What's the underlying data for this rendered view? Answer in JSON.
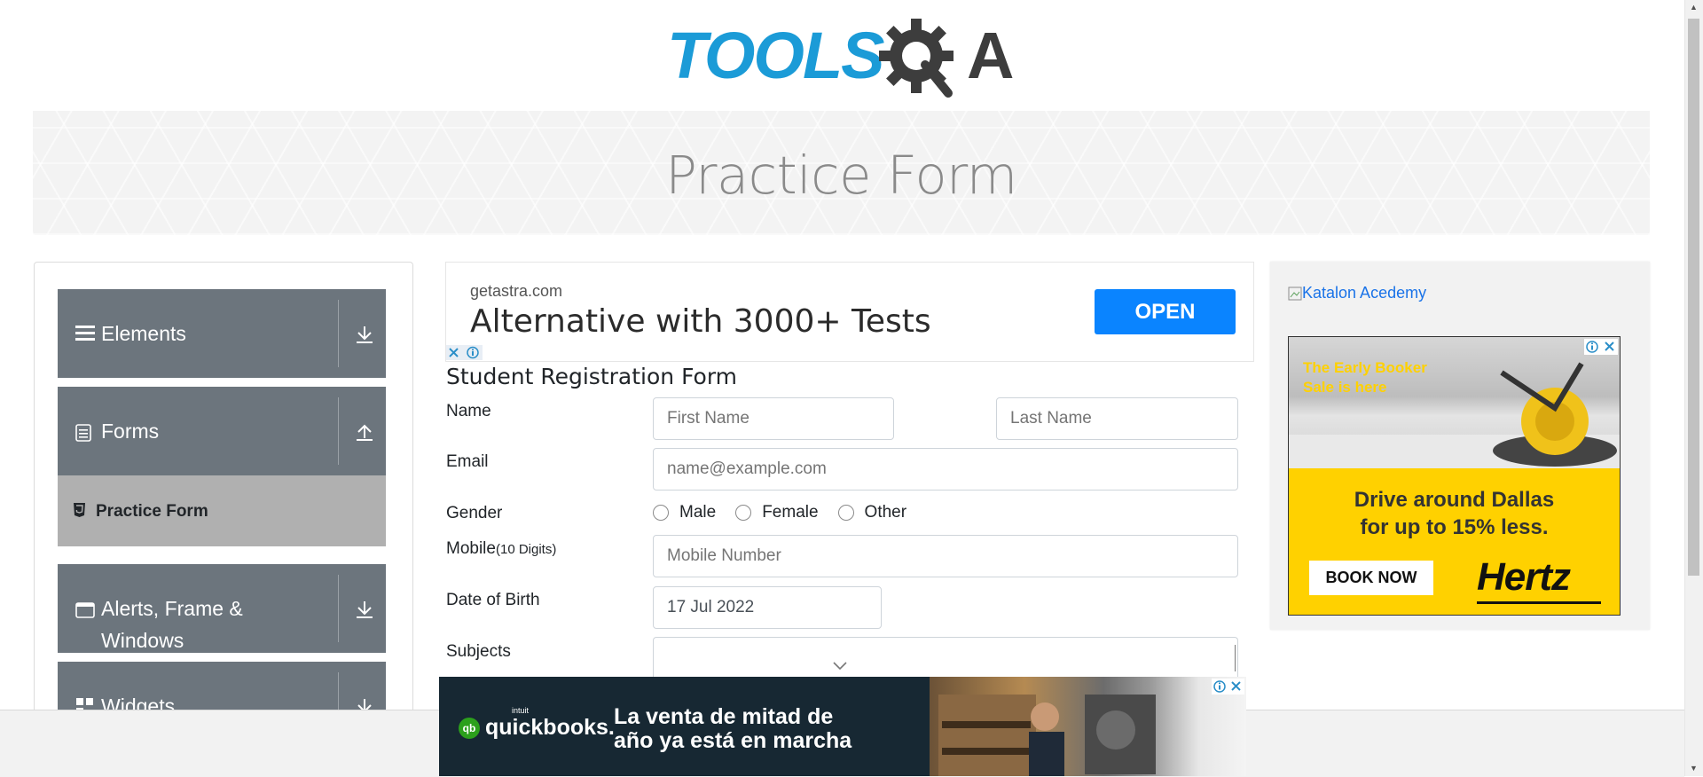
{
  "header": {
    "logo_text": "TOOLSQA"
  },
  "banner": {
    "title": "Practice Form"
  },
  "sidebar": {
    "groups": [
      {
        "label": "Elements",
        "icon": "hamburger-icon",
        "arrow": "download-arrow-icon"
      },
      {
        "label": "Forms",
        "icon": "document-icon",
        "arrow": "upload-arrow-icon"
      },
      {
        "label": "Alerts, Frame &",
        "label2": "Windows",
        "icon": "window-icon",
        "arrow": "download-arrow-icon"
      },
      {
        "label": "Widgets",
        "icon": "widgets-icon",
        "arrow": "download-arrow-icon"
      }
    ],
    "active_item": {
      "label": "Practice Form",
      "icon": "html5-icon"
    }
  },
  "ad_top": {
    "domain": "getastra.com",
    "headline": "Alternative with 3000+ Tests",
    "button": "OPEN"
  },
  "form": {
    "title": "Student Registration Form",
    "name_label": "Name",
    "first_name_placeholder": "First Name",
    "last_name_placeholder": "Last Name",
    "email_label": "Email",
    "email_placeholder": "name@example.com",
    "gender_label": "Gender",
    "gender_options": [
      "Male",
      "Female",
      "Other"
    ],
    "mobile_label": "Mobile",
    "mobile_hint": "(10 Digits)",
    "mobile_placeholder": "Mobile Number",
    "dob_label": "Date of Birth",
    "dob_value": "17 Jul 2022",
    "subjects_label": "Subjects"
  },
  "right_ad": {
    "katalon_alt": "Katalon Acedemy",
    "early_booker": [
      "The Early Booker",
      "Sale is here"
    ],
    "headline": [
      "Drive around Dallas",
      "for up to 15% less."
    ],
    "button": "BOOK NOW",
    "brand": "Hertz"
  },
  "bottom_ad": {
    "brand_small": "intuit",
    "brand": "quickbooks.",
    "headline": [
      "La venta de mitad de",
      "año ya está en marcha"
    ]
  },
  "colors": {
    "logo_blue": "#1b9bd7",
    "logo_dark": "#3d3d3d",
    "sidebar_gray": "#6c757d",
    "active_gray": "#b0b0b0",
    "open_button": "#0a84ff",
    "hertz_yellow": "#ffd100",
    "quickbooks_bg": "#172833"
  }
}
